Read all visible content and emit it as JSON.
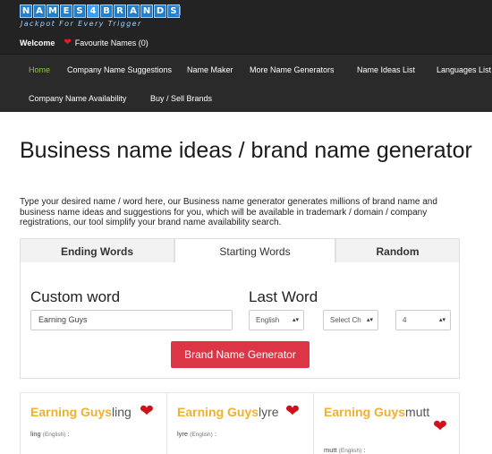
{
  "logo": {
    "letters": [
      "N",
      "A",
      "M",
      "E",
      "S",
      "4",
      "B",
      "R",
      "A",
      "N",
      "D",
      "S"
    ],
    "tagline": "Jackpot For Every Trigger"
  },
  "header": {
    "welcome": "Welcome",
    "favourites": "Favourite Names (0)"
  },
  "nav": {
    "row1": [
      "Home",
      "Company Name Suggestions",
      "Name Maker",
      "More Name Generators",
      "Name Ideas List",
      "Languages List"
    ],
    "row2": [
      "Company Name Availability",
      "Buy / Sell Brands"
    ]
  },
  "main": {
    "title": "Business name ideas / brand name generator",
    "intro": "Type your desired name / word here, our Business name generator generates millions of brand name and business name ideas and suggestions for you, which will be available in trademark / domain / company registrations, our tool simplify your brand name availability search."
  },
  "tabs": [
    "Ending Words",
    "Starting Words",
    "Random"
  ],
  "form": {
    "custom_label": "Custom word",
    "custom_value": "Earning Guys",
    "last_label": "Last Word",
    "language": "English",
    "choice": "Select Ch",
    "count": "4",
    "button": "Brand Name Generator"
  },
  "results": [
    {
      "base": "Earning Guys",
      "suffix": "ling",
      "word": "ling",
      "lang": "(English)",
      "sep": ":"
    },
    {
      "base": "Earning Guys",
      "suffix": "lyre",
      "word": "lyre",
      "lang": "(English)",
      "sep": ":"
    },
    {
      "base": "Earning Guys",
      "suffix": "mutt",
      "word": "mutt",
      "lang": "(English)",
      "sep": ":"
    }
  ],
  "colors": {
    "nav_active": "#8cc63f",
    "button": "#dc3545",
    "name_highlight": "#f0b030",
    "heart": "#d0101a"
  },
  "icons": {
    "heart": "heart-icon",
    "dropdown": "chevron-updown-icon"
  }
}
